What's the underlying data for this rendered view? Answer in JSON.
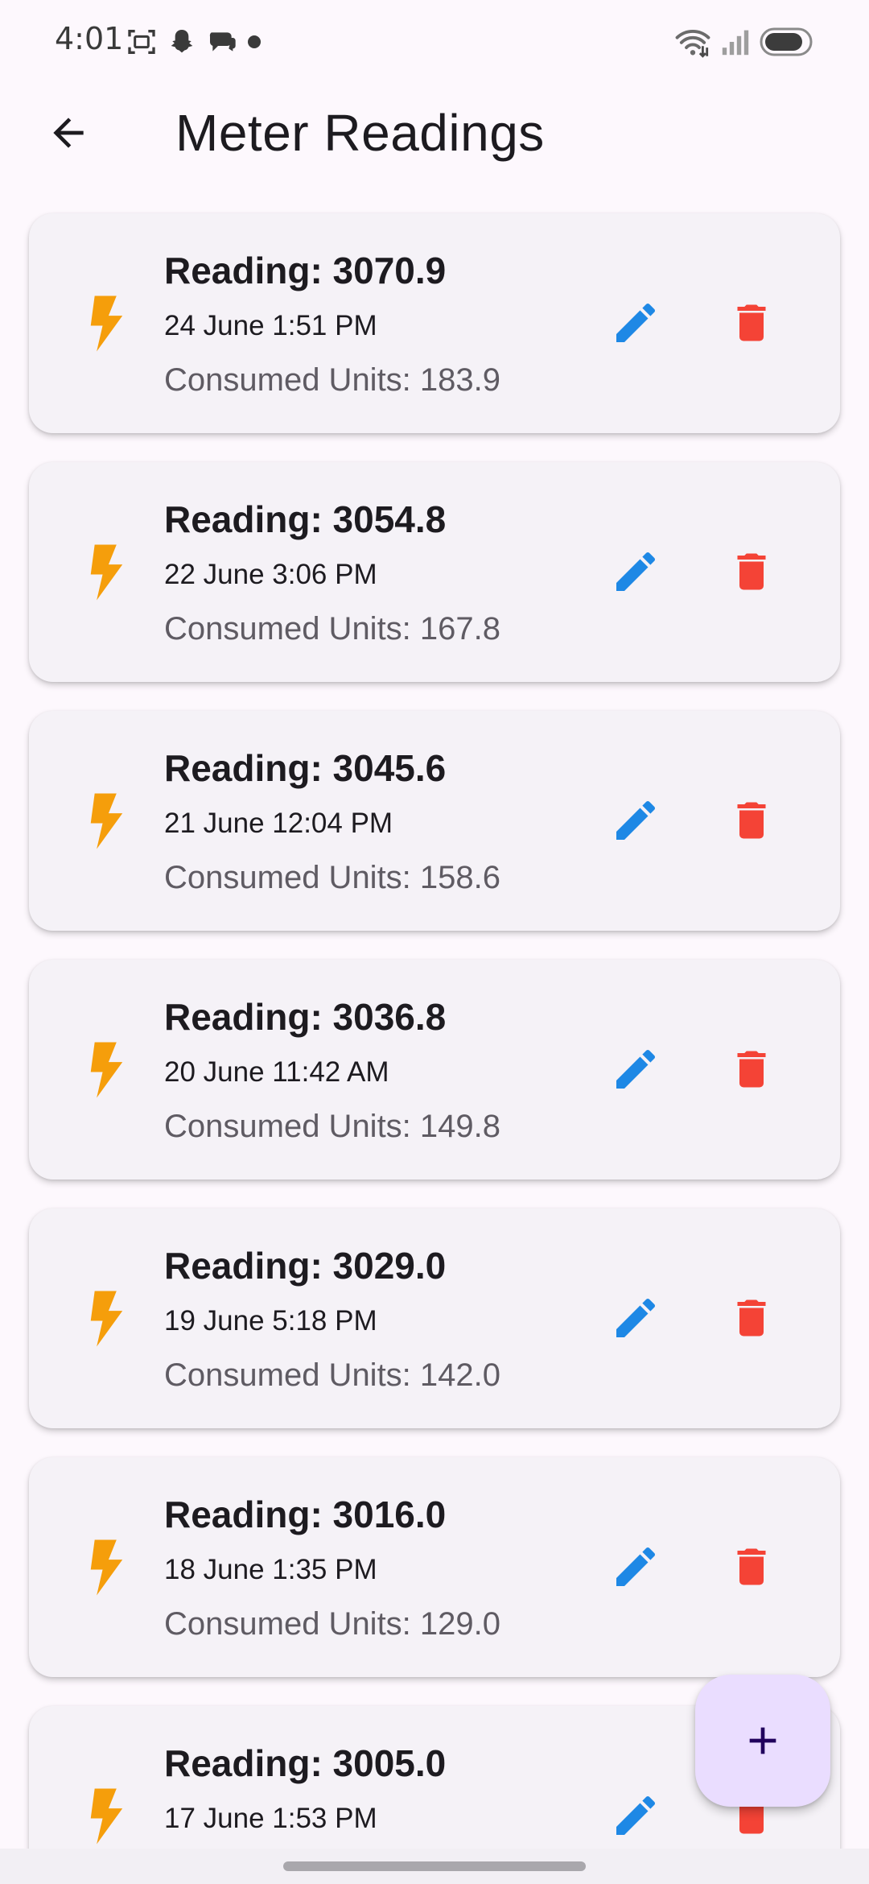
{
  "status_bar": {
    "time": "4:01",
    "left_icons": [
      "screenshot-icon",
      "snapchat-icon",
      "chat-icon",
      "dot-icon"
    ],
    "right_icons": [
      "wifi-icon",
      "signal-icon",
      "battery-icon"
    ]
  },
  "app_bar": {
    "title": "Meter Readings",
    "back_icon": "arrow-back-icon"
  },
  "colors": {
    "bolt": "#F59E0B",
    "edit": "#1E88E5",
    "delete": "#F44336",
    "fab": "#EADDFF",
    "card": "#F5F2F7",
    "background": "#FDF8FD"
  },
  "readings": [
    {
      "reading": "Reading: 3070.9",
      "date": "24 June 1:51 PM",
      "consumed": "Consumed Units: 183.9"
    },
    {
      "reading": "Reading: 3054.8",
      "date": "22 June 3:06 PM",
      "consumed": "Consumed Units: 167.8"
    },
    {
      "reading": "Reading: 3045.6",
      "date": "21 June 12:04 PM",
      "consumed": "Consumed Units: 158.6"
    },
    {
      "reading": "Reading: 3036.8",
      "date": "20 June 11:42 AM",
      "consumed": "Consumed Units: 149.8"
    },
    {
      "reading": "Reading: 3029.0",
      "date": "19 June 5:18 PM",
      "consumed": "Consumed Units: 142.0"
    },
    {
      "reading": "Reading: 3016.0",
      "date": "18 June 1:35 PM",
      "consumed": "Consumed Units: 129.0"
    },
    {
      "reading": "Reading: 3005.0",
      "date": "17 June 1:53 PM",
      "consumed": ""
    }
  ],
  "fab": {
    "icon": "plus-icon"
  }
}
